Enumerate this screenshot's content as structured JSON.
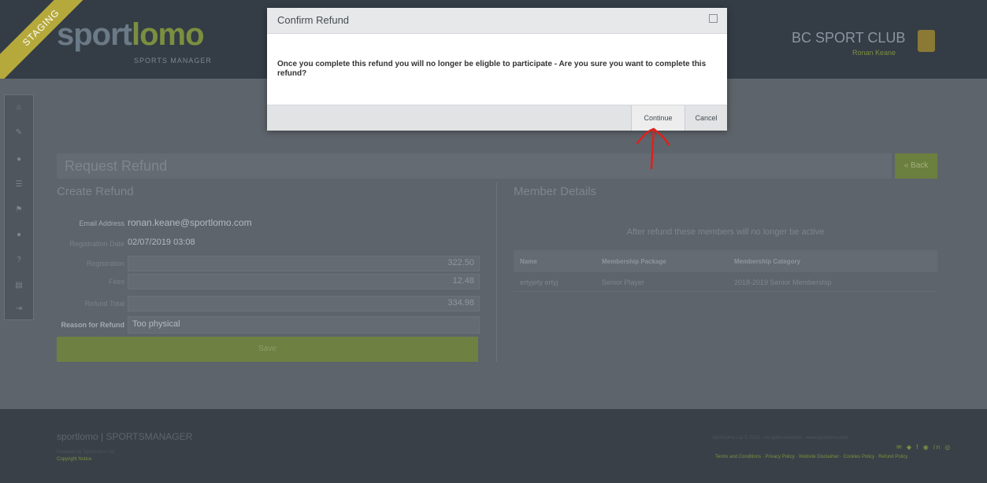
{
  "header": {
    "staging": "STAGING",
    "logo_main_a": "sport",
    "logo_main_b": "lomo",
    "logo_sub": "SPORTS MANAGER",
    "club_name": "BC SPORT CLUB",
    "user": "Ronan Keane"
  },
  "sidebar": {
    "icons": [
      "home-icon",
      "edit-icon",
      "user-icon",
      "list-icon",
      "flag-icon",
      "person-icon",
      "help-icon",
      "document-icon",
      "logout-icon"
    ],
    "glyphs": [
      "⌂",
      "✎",
      "●",
      "☰",
      "⚑",
      "●",
      "?",
      "▤",
      "⇥"
    ]
  },
  "page": {
    "title": "Request Refund",
    "back_label": "« Back"
  },
  "create_refund": {
    "title": "Create Refund",
    "email_label": "Email Address",
    "email_value": "ronan.keane@sportlomo.com",
    "reg_date_label": "Registration Date",
    "reg_date_value": "02/07/2019 03:08",
    "registration_label": "Registration",
    "registration_value": "322.50",
    "fees_label": "Fees",
    "fees_value": "12.48",
    "refund_total_label": "Refund Total",
    "refund_total_value": "334.98",
    "reason_label": "Reason for Refund",
    "reason_value": "Too physical",
    "save_label": "Save"
  },
  "member_details": {
    "title": "Member Details",
    "note": "After refund these members will no longer be active",
    "columns": [
      "Name",
      "Membership Package",
      "Membership Category"
    ],
    "rows": [
      [
        "ertyjety ertyj",
        "Senior Player",
        "2018-2019 Senior Membership"
      ]
    ]
  },
  "modal": {
    "title": "Confirm Refund",
    "message": "Once you complete this refund you will no longer be eligble to participate - Are you sure you want to complete this refund?",
    "continue_label": "Continue",
    "cancel_label": "Cancel"
  },
  "footer": {
    "logo": "sportlomo  |  SPORTSMANAGER",
    "powered": "Powered by SportLomo Ltd.",
    "copyright": "Copyright Notice",
    "right_line": "SportLomo Ltd © 2019 - All rights reserved - www.sportlomo.com",
    "links": "Terms and Conditions · Privacy Policy · Website Disclaimer · Cookies Policy · Refund Policy"
  },
  "colors": {
    "accent": "#7c8f3f",
    "header_bg": "#343d46",
    "annotation_arrow": "#e0201c"
  }
}
